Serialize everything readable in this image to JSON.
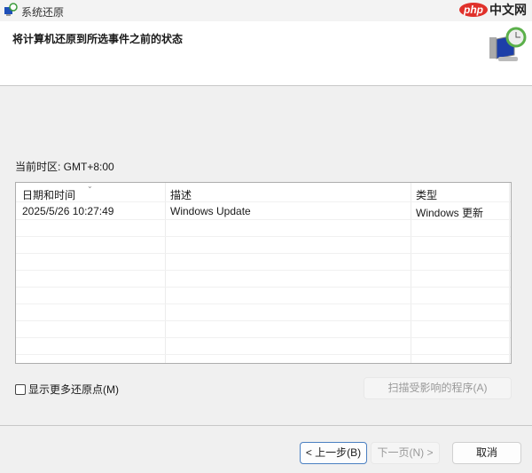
{
  "window": {
    "title": "系统还原",
    "watermark": "php中文网"
  },
  "header": {
    "title": "将计算机还原到所选事件之前的状态"
  },
  "timezone": "当前时区: GMT+8:00",
  "table": {
    "columns": [
      "日期和时间",
      "描述",
      "类型"
    ],
    "rows": [
      [
        "2025/5/26 10:27:49",
        "Windows Update",
        "Windows 更新"
      ]
    ]
  },
  "show_more": {
    "label": "显示更多还原点(M)",
    "checked": false
  },
  "buttons": {
    "scan": "扫描受影响的程序(A)",
    "back": "< 上一步(B)",
    "next": "下一页(N) >",
    "cancel": "取消"
  }
}
